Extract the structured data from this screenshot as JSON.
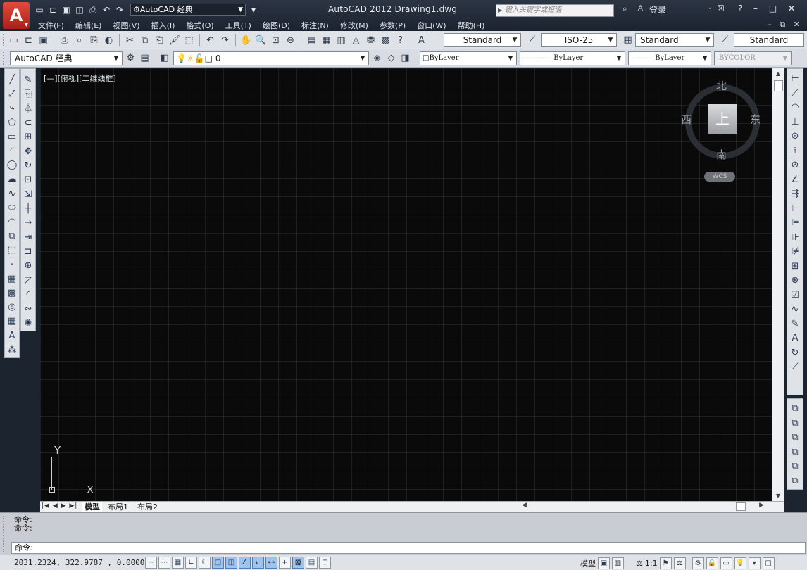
{
  "app": {
    "logo_letter": "A",
    "title": "AutoCAD 2012    Drawing1.dwg",
    "workspace": "AutoCAD 经典",
    "search_placeholder": "键入关键字或短语",
    "login": "登录",
    "help_icon": "?"
  },
  "menus": [
    "文件(F)",
    "编辑(E)",
    "视图(V)",
    "插入(I)",
    "格式(O)",
    "工具(T)",
    "绘图(D)",
    "标注(N)",
    "修改(M)",
    "参数(P)",
    "窗口(W)",
    "帮助(H)"
  ],
  "toolbar1": {
    "text_style": "Standard",
    "dim_style": "ISO-25",
    "table_style": "Standard",
    "mleader_style": "Standard"
  },
  "toolbar2": {
    "workspace": "AutoCAD 经典",
    "layer": "0",
    "color": "ByLayer",
    "linetype": "ByLayer",
    "lineweight": "ByLayer",
    "plotstyle": "BYCOLOR"
  },
  "viewport": {
    "label": "[—][俯视][二维线框]",
    "compass": {
      "north": "北",
      "south": "南",
      "east": "东",
      "west": "西",
      "face": "上"
    },
    "wcs": "WCS",
    "ucs_x": "X",
    "ucs_y": "Y"
  },
  "layout_tabs": [
    "模型",
    "布局1",
    "布局2"
  ],
  "command": {
    "history": [
      "命令:",
      "命令:"
    ],
    "prompt": "命令:"
  },
  "status": {
    "coords": "2031.2324, 322.9787 , 0.0000",
    "model": "模型",
    "annoscale": "1:1"
  },
  "icons": {
    "qat": [
      "new-icon",
      "open-icon",
      "save-icon",
      "saveas-icon",
      "plot-icon",
      "undo-icon",
      "redo-icon"
    ],
    "left_col1": [
      "line-icon",
      "construction-line-icon",
      "polyline-icon",
      "polygon-icon",
      "rectangle-icon",
      "arc-icon",
      "circle-icon",
      "revision-cloud-icon",
      "spline-icon",
      "ellipse-icon",
      "ellipse-arc-icon",
      "insert-block-icon",
      "make-block-icon",
      "point-icon",
      "hatch-icon",
      "gradient-icon",
      "region-icon",
      "table-icon",
      "mtext-icon",
      "add-selected-icon"
    ],
    "left_col2": [
      "erase-icon",
      "copy-icon",
      "mirror-icon",
      "offset-icon",
      "array-icon",
      "move-icon",
      "rotate-icon",
      "scale-icon",
      "stretch-icon",
      "trim-icon",
      "extend-icon",
      "break-at-point-icon",
      "break-icon",
      "join-icon",
      "chamfer-icon",
      "fillet-icon",
      "blend-icon",
      "explode-icon"
    ]
  }
}
